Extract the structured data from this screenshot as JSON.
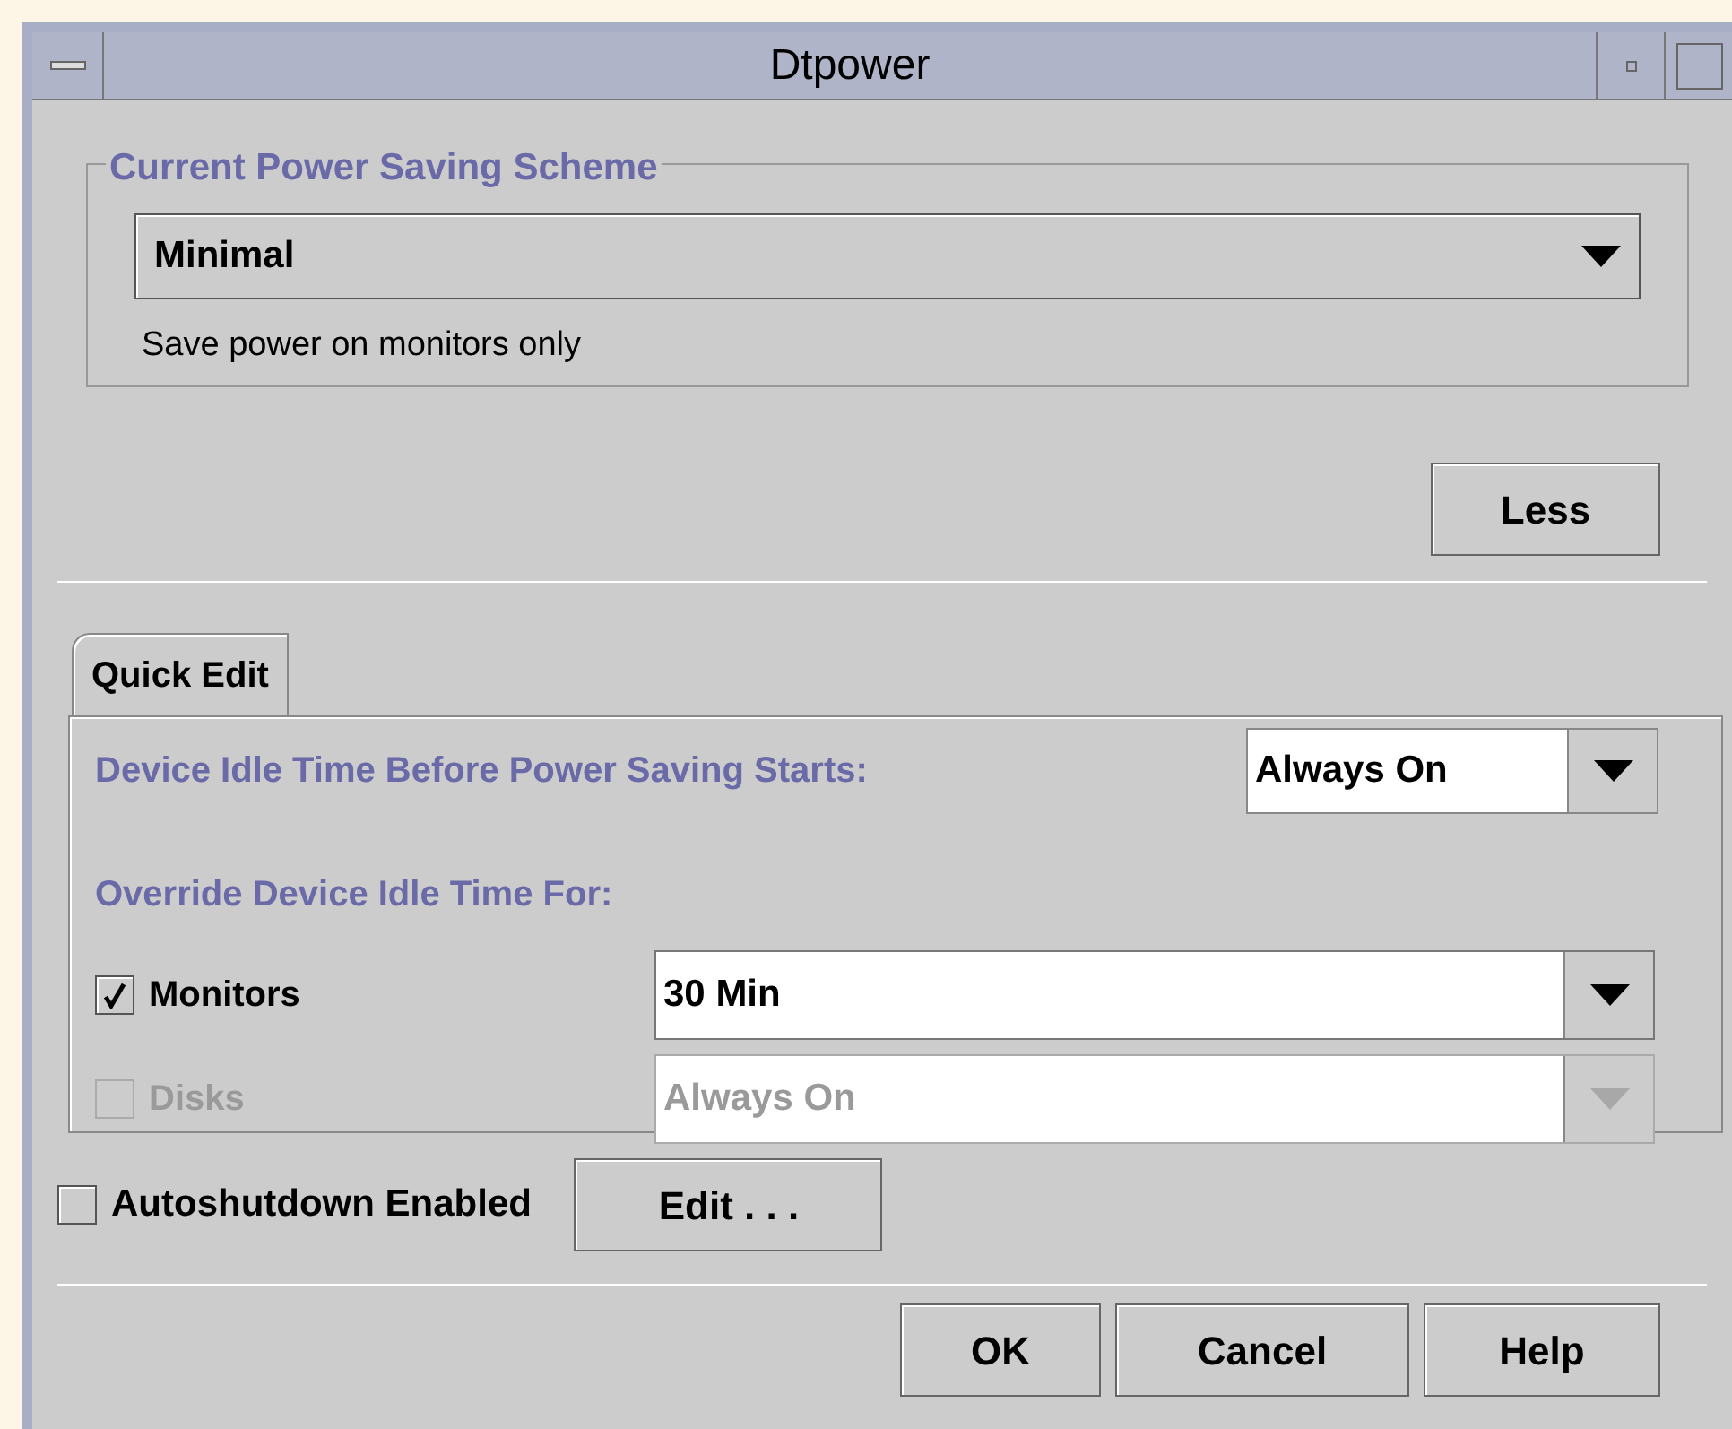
{
  "window": {
    "title": "Dtpower"
  },
  "scheme": {
    "legend": "Current Power Saving Scheme",
    "value": "Minimal",
    "description": "Save power on monitors only"
  },
  "less_button": "Less",
  "tabs": [
    {
      "label": "Quick Edit",
      "selected": true
    }
  ],
  "idle": {
    "label": "Device Idle Time Before Power Saving Starts:",
    "value": "Always On"
  },
  "override": {
    "label": "Override Device Idle Time For:",
    "devices": [
      {
        "name": "Monitors",
        "checked": true,
        "disabled": false,
        "value": "30 Min"
      },
      {
        "name": "Disks",
        "checked": false,
        "disabled": true,
        "value": "Always On"
      }
    ]
  },
  "autoshutdown": {
    "label": "Autoshutdown Enabled",
    "checked": false
  },
  "edit_button": "Edit . . .",
  "buttons": [
    "OK",
    "Cancel",
    "Help"
  ]
}
